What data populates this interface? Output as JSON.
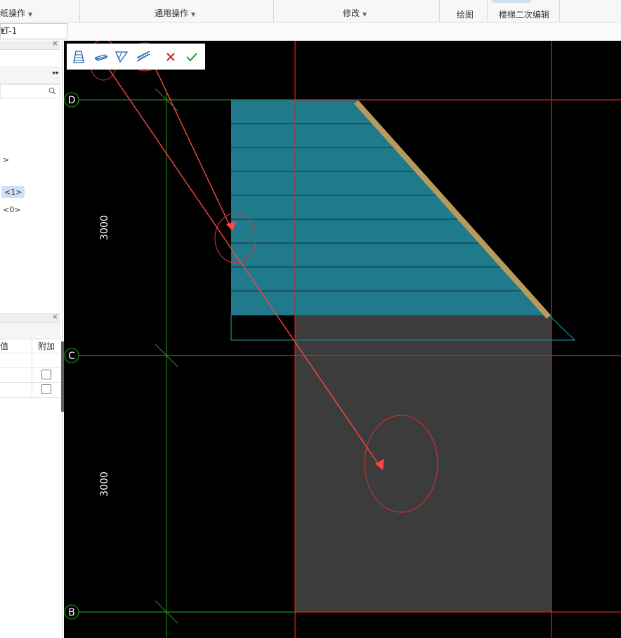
{
  "ribbon": {
    "groups": [
      {
        "label": "纸操作"
      },
      {
        "label": "通用操作"
      },
      {
        "label": "修改"
      },
      {
        "label": "绘图"
      },
      {
        "label": "楼梯二次编辑"
      }
    ]
  },
  "selector": {
    "value": "LT-1"
  },
  "left_panel": {
    "search_placeholder": "",
    "tree": [
      {
        "label": ">"
      },
      {
        "label": "<1>"
      },
      {
        "label": "<0>"
      }
    ],
    "props": {
      "headers": [
        "值",
        "附加"
      ],
      "rows": [
        {
          "value": "",
          "attached": false
        },
        {
          "value": "",
          "attached": false
        }
      ]
    }
  },
  "toolbar": {
    "tools": [
      {
        "icon": "stair-flight-icon"
      },
      {
        "icon": "landing-slab-icon"
      },
      {
        "icon": "stair-beam-icon"
      },
      {
        "icon": "railing-icon"
      },
      {
        "icon": "cancel-icon"
      },
      {
        "icon": "confirm-icon"
      }
    ]
  },
  "drawing": {
    "axes": [
      "D",
      "C",
      "B"
    ],
    "dimensions": [
      "3000",
      "3000"
    ],
    "colors": {
      "background": "#000000",
      "grid_red": "#e02020",
      "grid_green": "#1f8a1f",
      "stair_fill": "#1f7a8c",
      "landing_fill": "#3c3c3c",
      "railing": "#b89a5c",
      "annotation": "#ff4444"
    }
  }
}
